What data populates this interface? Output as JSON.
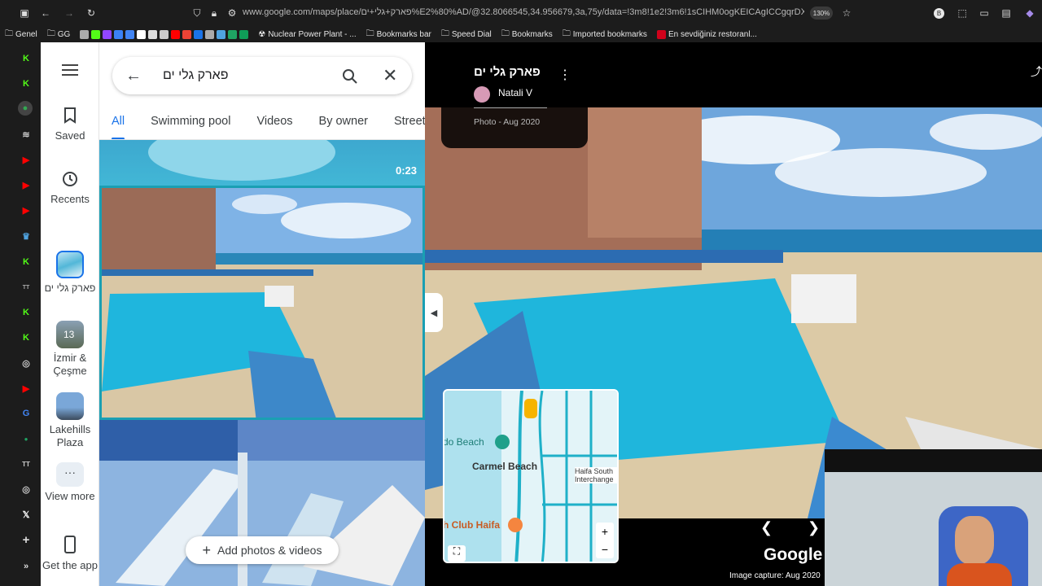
{
  "browser": {
    "url": "www.google.com/maps/place/פארק+גלי+ים%E2%80%AD/@32.8066545,34.956679,3a,75y/data=!3m8!1e2!3m6!1sCIHM0ogKEICAgICCgqrDXw!2e10",
    "zoom": "130%",
    "bookmarks": [
      "Genel",
      "GG",
      "Nuclear Power Plant - ...",
      "Bookmarks bar",
      "Speed Dial",
      "Bookmarks",
      "Imported bookmarks",
      "En sevdiğiniz restoranl..."
    ]
  },
  "rail": {
    "saved": "Saved",
    "recents": "Recents",
    "item1": "פארק גלי ים",
    "item2": "İzmir & Çeşme",
    "item2_badge": "13",
    "item3": "Lakehills Plaza",
    "view_more": "View more",
    "get_app": "Get the app"
  },
  "search": {
    "value": "פארק גלי ים"
  },
  "tabs": [
    "All",
    "Swimming pool",
    "Videos",
    "By owner",
    "Street"
  ],
  "grid": {
    "video_duration": "0:23",
    "add_button": "Add photos & videos"
  },
  "viewer": {
    "place_title": "פארק גלי ים",
    "author": "Natali V",
    "date": "Photo - Aug 2020",
    "google_logo": "Google",
    "capture": "Image capture: Aug 2020"
  },
  "minimap": {
    "labels": [
      "Carmel Beach",
      "do Beach",
      "Haifa South Interchange",
      "h Club Haifa"
    ]
  },
  "colors": {
    "pool": "#17b7d6",
    "accent": "#1a73e8",
    "sky": "#6fa9dc"
  }
}
